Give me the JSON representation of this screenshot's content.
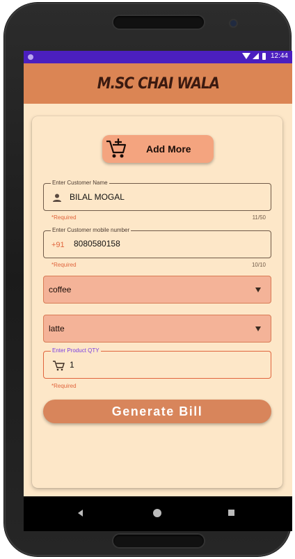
{
  "status_bar": {
    "time": "12:44"
  },
  "app_bar": {
    "title": "M.SC CHAI WALA"
  },
  "add_more": {
    "label": "Add More",
    "icon": "add-shopping-cart-icon"
  },
  "customer_name": {
    "label": "Enter Customer Name",
    "value": "BILAL MOGAL",
    "helper": "*Required",
    "counter": "11/50",
    "icon": "person-icon"
  },
  "customer_mobile": {
    "label": "Enter Customer mobile number",
    "prefix": "+91",
    "value": "8080580158",
    "helper": "*Required",
    "counter": "10/10"
  },
  "category_select": {
    "value": "coffee"
  },
  "product_select": {
    "value": "latte"
  },
  "product_qty": {
    "label": "Enter Product QTY",
    "value": "1",
    "helper": "*Required",
    "icon": "cart-icon"
  },
  "generate_bill": {
    "label": "Generate Bill"
  },
  "colors": {
    "status_bar": "#4b1fbf",
    "app_bar": "#db8554",
    "background": "#fde7c8",
    "accent": "#e0643c",
    "dropdown": "#f4b398",
    "button": "#d8855b"
  }
}
